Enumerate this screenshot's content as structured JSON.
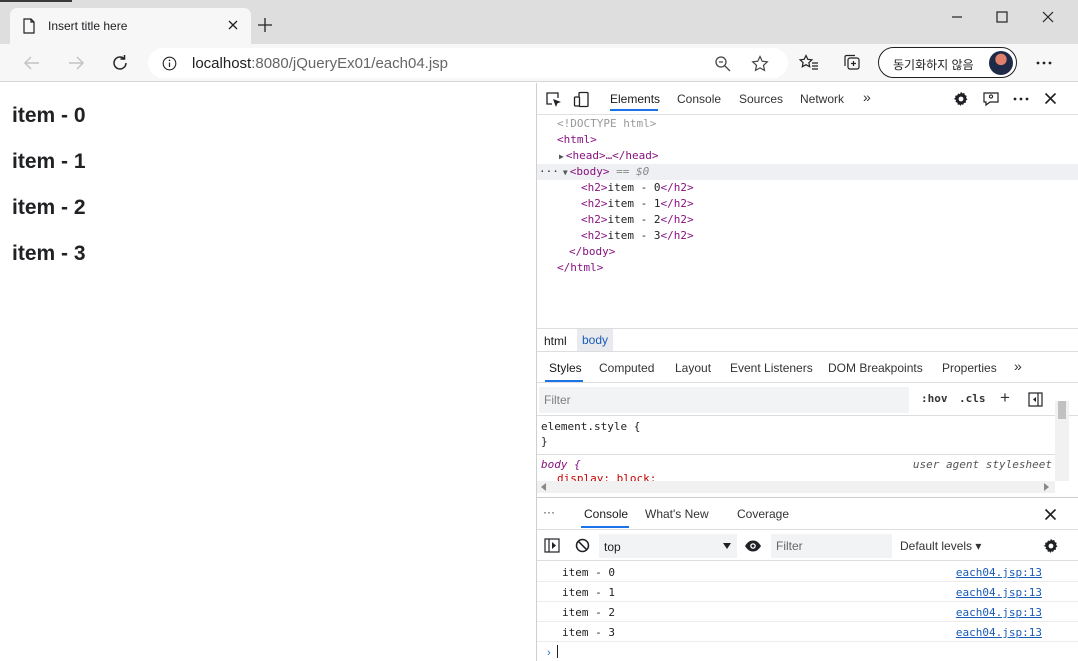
{
  "browser": {
    "tab_title": "Insert title here",
    "url_host": "localhost",
    "url_rest": ":8080/jQueryEx01/each04.jsp",
    "sync_label": "동기화하지 않음"
  },
  "page": {
    "headings": [
      "item - 0",
      "item - 1",
      "item - 2",
      "item - 3"
    ]
  },
  "devtools": {
    "tabs": [
      "Elements",
      "Console",
      "Sources",
      "Network"
    ],
    "more": "»",
    "dom": {
      "doctype": "<!DOCTYPE html>",
      "html_open": "<html>",
      "head": "<head>…</head>",
      "body_open": "<body>",
      "body_marker": "== $0",
      "ellipsis": "···",
      "h2_lines": [
        "item - 0",
        "item - 1",
        "item - 2",
        "item - 3"
      ],
      "body_close": "</body>",
      "html_close": "</html>"
    },
    "breadcrumbs": [
      "html",
      "body"
    ],
    "style_tabs": [
      "Styles",
      "Computed",
      "Layout",
      "Event Listeners",
      "DOM Breakpoints",
      "Properties"
    ],
    "styles_filter_placeholder": "Filter",
    "hov": ":hov",
    "cls": ".cls",
    "plus": "+",
    "element_style": "element.style {",
    "close_brace": "}",
    "body_rule": "body {",
    "body_rule_source": "user agent stylesheet",
    "body_decl": "display: block;",
    "drawer_tabs": [
      "Console",
      "What's New",
      "Coverage"
    ],
    "drawer_more": "···",
    "context": "top",
    "console_filter_placeholder": "Filter",
    "levels": "Default levels ▾",
    "console_lines": [
      {
        "msg": "item - 0",
        "src": "each04.jsp:13"
      },
      {
        "msg": "item - 1",
        "src": "each04.jsp:13"
      },
      {
        "msg": "item - 2",
        "src": "each04.jsp:13"
      },
      {
        "msg": "item - 3",
        "src": "each04.jsp:13"
      }
    ],
    "prompt": "›"
  },
  "colors": {
    "accent": "#1a73e8",
    "tag": "#881280",
    "link": "#1a5bb8"
  }
}
